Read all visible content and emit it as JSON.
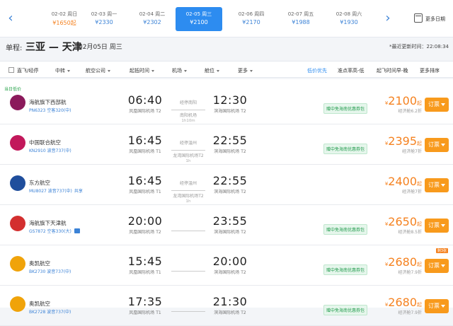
{
  "datebar": {
    "prev_arrow": "‹",
    "next_arrow": "›",
    "dates": [
      {
        "date": "02-02",
        "weekday": "周日",
        "price": "¥1650起",
        "low": true
      },
      {
        "date": "02-03",
        "weekday": "周一",
        "price": "¥2330",
        "low": false
      },
      {
        "date": "02-04",
        "weekday": "周二",
        "price": "¥2302",
        "low": false
      },
      {
        "date": "02-05",
        "weekday": "周三",
        "price": "¥2100",
        "low": false,
        "active": true
      },
      {
        "date": "02-06",
        "weekday": "周四",
        "price": "¥2170",
        "low": false
      },
      {
        "date": "02-07",
        "weekday": "周五",
        "price": "¥1988",
        "low": false
      },
      {
        "date": "02-08",
        "weekday": "周六",
        "price": "¥1930",
        "low": false
      }
    ],
    "more_dates": "更多日期"
  },
  "route": {
    "kind": "单程:",
    "cities": "三亚 — 天津",
    "date": "02月05日 周三",
    "updated": "*最近更新时间：22:08:34"
  },
  "filters": {
    "direct": "直飞/经停",
    "transfer": "中转",
    "airline": "航空公司",
    "dep_time": "起抵时间",
    "airport": "机场",
    "cabin": "舱位",
    "more": "更多",
    "low_price": "低价优先",
    "ontime": "准点率高-低",
    "dep_early": "起飞时间早-晚",
    "more_sort": "更多排序"
  },
  "list": {
    "rec_tag": "当日低价",
    "flights": [
      {
        "airline": "海航旗下西部航",
        "flight_no": "PN6323",
        "plane": "空客320(中)",
        "share": "",
        "dep_time": "06:40",
        "dep_airport": "凤凰国际机场 T2",
        "arr_time": "12:30",
        "arr_airport": "滨海国际机场 T2",
        "via": "经停南阳",
        "stop_airport": "南阳机场",
        "stop_duration": "1h10m",
        "promo": "赠中免海南优惠券包",
        "price": "2100",
        "price_suffix": "起",
        "discount": "经济舱6.2折",
        "book": "订票",
        "logo_color": "#8b1a5b",
        "remaining": ""
      },
      {
        "airline": "中国联合航空",
        "flight_no": "KN2910",
        "plane": "波音737(中)",
        "share": "",
        "dep_time": "16:45",
        "dep_airport": "凤凰国际机场 T1",
        "arr_time": "22:55",
        "arr_airport": "滨海国际机场 T2",
        "via": "经停温州",
        "stop_airport": "龙湾国际机场T2",
        "stop_duration": "1h",
        "promo": "赠中免海南优惠券包",
        "price": "2395",
        "price_suffix": "起",
        "discount": "经济舱7折",
        "book": "订票",
        "logo_color": "#c2185b",
        "remaining": ""
      },
      {
        "airline": "东方航空",
        "flight_no": "MU8027",
        "plane": "波音737(中)",
        "share": "共享",
        "dep_time": "16:45",
        "dep_airport": "凤凰国际机场 T1",
        "arr_time": "22:55",
        "arr_airport": "滨海国际机场 T2",
        "via": "经停温州",
        "stop_airport": "龙湾国际机场T2",
        "stop_duration": "1h",
        "promo": "",
        "price": "2400",
        "price_suffix": "起",
        "discount": "经济舱7折",
        "book": "订票",
        "logo_color": "#1f4e9c",
        "remaining": ""
      },
      {
        "airline": "海航旗下天津航",
        "flight_no": "GS7872",
        "plane": "空客330(大)",
        "share": "",
        "dep_time": "20:00",
        "dep_airport": "凤凰国际机场 T2",
        "arr_time": "23:55",
        "arr_airport": "滨海国际机场 T2",
        "via": "",
        "stop_airport": "",
        "stop_duration": "",
        "promo": "赠中免海南优惠券包",
        "price": "2650",
        "price_suffix": "起",
        "discount": "经济舱8.5折",
        "book": "订票",
        "logo_color": "#d32f2f",
        "remaining": "",
        "tv": true
      },
      {
        "airline": "奥凯航空",
        "flight_no": "BK2730",
        "plane": "波音737(中)",
        "share": "",
        "dep_time": "15:45",
        "dep_airport": "凤凰国际机场 T1",
        "arr_time": "20:00",
        "arr_airport": "滨海国际机场 T2",
        "via": "",
        "stop_airport": "",
        "stop_duration": "",
        "promo": "赠中免海南优惠券包",
        "price": "2680",
        "price_suffix": "起",
        "discount": "经济舱7.9折",
        "book": "订票",
        "logo_color": "#f0a30a",
        "remaining": "剩3张"
      },
      {
        "airline": "奥凯航空",
        "flight_no": "BK2728",
        "plane": "波音737(中)",
        "share": "",
        "dep_time": "17:35",
        "dep_airport": "凤凰国际机场 T1",
        "arr_time": "21:30",
        "arr_airport": "滨海国际机场 T2",
        "via": "",
        "stop_airport": "",
        "stop_duration": "",
        "promo": "赠中免海南优惠券包",
        "price": "2680",
        "price_suffix": "起",
        "discount": "经济舱7.9折",
        "book": "订票",
        "logo_color": "#f0a30a",
        "remaining": ""
      }
    ]
  }
}
